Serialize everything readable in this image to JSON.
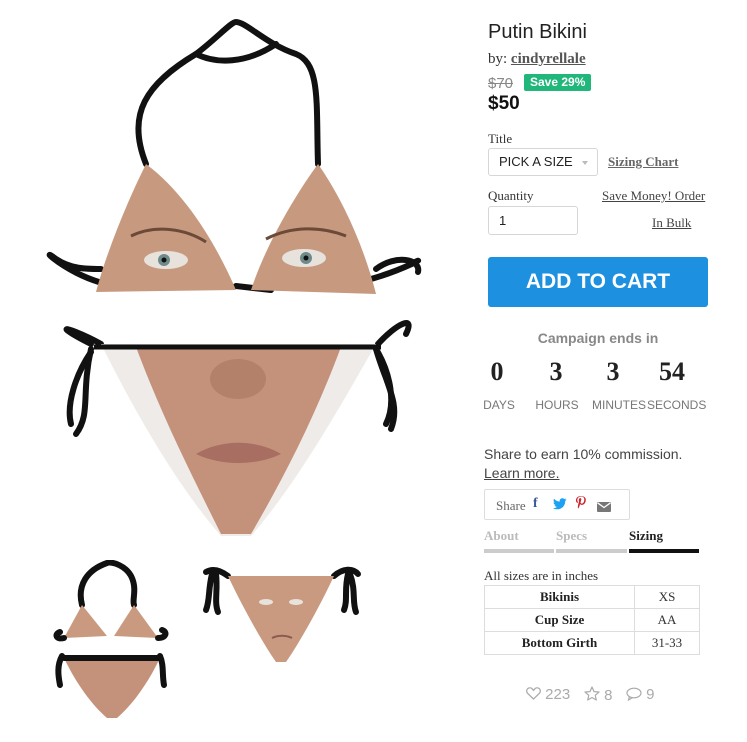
{
  "product": {
    "title": "Putin Bikini",
    "by_prefix": "by: ",
    "author": "cindyrellale",
    "old_price": "$70",
    "save_badge": "Save 29%",
    "price": "$50"
  },
  "options": {
    "title_label": "Title",
    "size_value": "PICK A SIZE",
    "sizing_chart_link": "Sizing Chart",
    "quantity_label": "Quantity",
    "quantity_value": "1",
    "bulk_link_line1": "Save Money! Order",
    "bulk_link_line2": "In Bulk"
  },
  "cart": {
    "add_to_cart": "ADD TO CART"
  },
  "campaign": {
    "label": "Campaign ends in",
    "days": "0",
    "hours": "3",
    "minutes": "3",
    "seconds": "54",
    "days_label": "DAYS",
    "hours_label": "HOURS",
    "minutes_label": "MINUTES",
    "seconds_label": "SECONDS"
  },
  "share": {
    "commission_text": "Share to earn 10% commission.",
    "learn_more": "Learn more.",
    "share_label": "Share",
    "icons": [
      "facebook-icon",
      "twitter-icon",
      "pinterest-icon",
      "email-icon"
    ]
  },
  "tabs": [
    {
      "label": "About",
      "active": false
    },
    {
      "label": "Specs",
      "active": false
    },
    {
      "label": "Sizing",
      "active": true
    }
  ],
  "sizing": {
    "note": "All sizes are in inches",
    "rows": [
      {
        "name": "Bikinis",
        "value": "XS"
      },
      {
        "name": "Cup Size",
        "value": "AA"
      },
      {
        "name": "Bottom Girth",
        "value": "31-33"
      }
    ]
  },
  "stats": {
    "likes": "223",
    "favorites": "8",
    "comments": "9"
  },
  "colors": {
    "accent_blue": "#1e90e0",
    "save_green": "#21b67a",
    "facebook": "#3b5998",
    "twitter": "#1da1f2",
    "pinterest": "#cb2027",
    "email": "#777777"
  }
}
